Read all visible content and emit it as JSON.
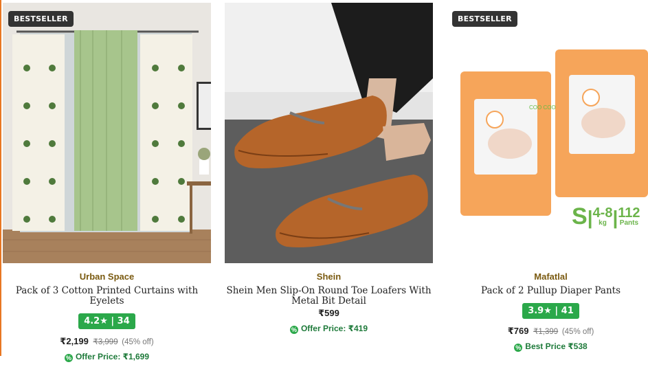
{
  "products": [
    {
      "badge": "BESTSELLER",
      "brand": "Urban Space",
      "title": "Pack of 3 Cotton Printed Curtains with Eyelets",
      "rating": "4.2★ | 34",
      "price": "₹2,199",
      "mrp": "₹3,999",
      "discount": "(45% off)",
      "offer": "Offer Price: ₹1,699"
    },
    {
      "brand": "Shein",
      "title": "Shein Men Slip-On Round Toe Loafers With Metal Bit Detail",
      "price": "₹599",
      "offer": "Offer Price: ₹419"
    },
    {
      "badge": "BESTSELLER",
      "brand": "Mafatlal",
      "title": "Pack of 2 Pullup Diaper Pants",
      "rating": "3.9★ | 41",
      "price": "₹769",
      "mrp": "₹1,399",
      "discount": "(45% off)",
      "offer": "Best Price ₹538",
      "pack_text": {
        "size": "S",
        "weight": "4-8",
        "weight_unit": "kg",
        "count": "112",
        "count_unit": "Pants",
        "product_logo": "COO COO"
      }
    }
  ],
  "colors": {
    "rating_bg": "#2ba84a",
    "brand": "#7a5a10",
    "offer": "#1e7a3a",
    "edge": "#e87722"
  }
}
